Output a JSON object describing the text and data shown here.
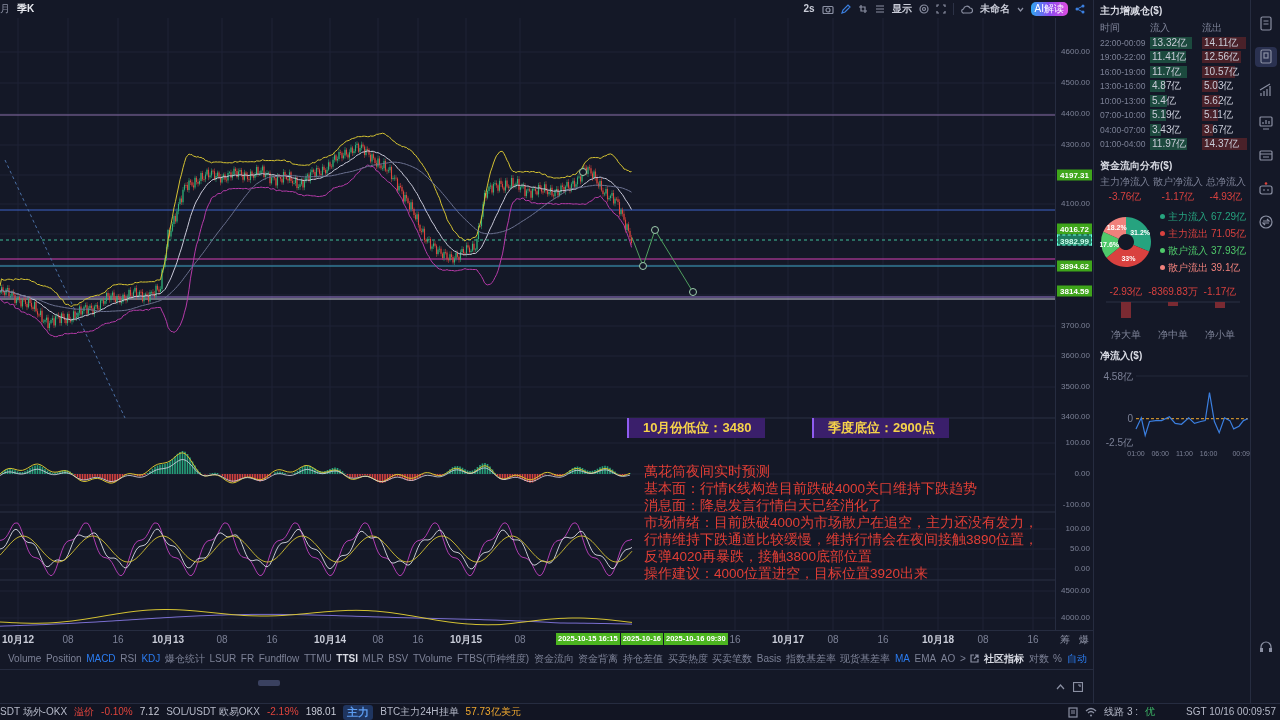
{
  "top_bar": {
    "periods": [
      {
        "label": "月",
        "selected": false
      },
      {
        "label": "季K",
        "selected": true
      }
    ],
    "interval": "2s",
    "display_label": "显示",
    "layout_name": "未命名",
    "ai_button": "AI解读"
  },
  "price_axis": {
    "labels": [
      "4600.00",
      "4500.00",
      "4400.00",
      "4300.00",
      "4100.00",
      "3700.00",
      "3600.00",
      "3500.00",
      "3400.00"
    ],
    "markers": [
      {
        "label": "4197.31",
        "kind": "price"
      },
      {
        "label": "4016.72",
        "kind": "price"
      },
      {
        "label": "3982.99",
        "kind": "current"
      },
      {
        "label": "3894.62",
        "kind": "price"
      },
      {
        "label": "3814.59",
        "kind": "price"
      }
    ]
  },
  "indicator_axes": [
    {
      "labels": [
        "100.00",
        "0.00",
        "-100.00"
      ]
    },
    {
      "labels": [
        "100.00",
        "50.00",
        "0.00"
      ]
    },
    {
      "labels": [
        "4500.00",
        "4000.00"
      ]
    }
  ],
  "chart_annotations": {
    "boxes": [
      "10月份低位：3480",
      "季度底位：2900点"
    ],
    "note_lines": [
      "萬花筒夜间实时预测",
      "基本面：行情K线构造目前跌破4000关口维持下跌趋势",
      "消息面：降息发言行情白天已经消化了",
      "市场情绪：目前跌破4000为市场散户在追空，主力还没有发力，",
      "行情维持下跌通道比较缓慢，维持行情会在夜间接触3890位置，",
      "反弹4020再暴跌，接触3800底部位置",
      "操作建议：4000位置进空，目标位置3920出来"
    ]
  },
  "time_axis": [
    {
      "label": "10月12",
      "kind": "day"
    },
    {
      "label": "08",
      "kind": "hour"
    },
    {
      "label": "16",
      "kind": "hour"
    },
    {
      "label": "10月13",
      "kind": "day"
    },
    {
      "label": "08",
      "kind": "hour"
    },
    {
      "label": "16",
      "kind": "hour"
    },
    {
      "label": "10月14",
      "kind": "day"
    },
    {
      "label": "08",
      "kind": "hour"
    },
    {
      "label": "16",
      "kind": "hour"
    },
    {
      "label": "10月15",
      "kind": "day"
    },
    {
      "label": "08",
      "kind": "hour"
    },
    {
      "label": "2025-10-15 16:15",
      "kind": "cursor"
    },
    {
      "label": "2025-10-16",
      "kind": "cursor"
    },
    {
      "label": "2025-10-16 09:30",
      "kind": "cursor"
    },
    {
      "label": "16",
      "kind": "hour"
    },
    {
      "label": "10月17",
      "kind": "day"
    },
    {
      "label": "08",
      "kind": "hour"
    },
    {
      "label": "16",
      "kind": "hour"
    },
    {
      "label": "10月18",
      "kind": "day"
    },
    {
      "label": "08",
      "kind": "hour"
    },
    {
      "label": "16",
      "kind": "hour"
    }
  ],
  "axis_corner": [
    "筹",
    "爆"
  ],
  "indicator_tabs": [
    {
      "label": "Volume",
      "selected": false,
      "emphasized": false
    },
    {
      "label": "Position",
      "selected": false,
      "emphasized": false
    },
    {
      "label": "MACD",
      "selected": true,
      "emphasized": false
    },
    {
      "label": "RSI",
      "selected": false,
      "emphasized": false
    },
    {
      "label": "KDJ",
      "selected": true,
      "emphasized": false
    },
    {
      "label": "爆仓统计",
      "selected": false,
      "emphasized": false
    },
    {
      "label": "LSUR",
      "selected": false,
      "emphasized": false
    },
    {
      "label": "FR",
      "selected": false,
      "emphasized": false
    },
    {
      "label": "Fundflow",
      "selected": false,
      "emphasized": false
    },
    {
      "label": "TTMU",
      "selected": false,
      "emphasized": false
    },
    {
      "label": "TTSI",
      "selected": false,
      "emphasized": true
    },
    {
      "label": "MLR",
      "selected": false,
      "emphasized": false
    },
    {
      "label": "BSV",
      "selected": false,
      "emphasized": false
    },
    {
      "label": "TVolume",
      "selected": false,
      "emphasized": false
    },
    {
      "label": "FTBS(币种维度)",
      "selected": false,
      "emphasized": false
    },
    {
      "label": "资金流向",
      "selected": false,
      "emphasized": false
    },
    {
      "label": "资金背离",
      "selected": false,
      "emphasized": false
    },
    {
      "label": "持仓差值",
      "selected": false,
      "emphasized": false
    },
    {
      "label": "买卖热度",
      "selected": false,
      "emphasized": false
    },
    {
      "label": "买卖笔数",
      "selected": false,
      "emphasized": false
    },
    {
      "label": "Basis",
      "selected": false,
      "emphasized": false
    },
    {
      "label": "指数基差率",
      "selected": false,
      "emphasized": false
    },
    {
      "label": "现货基差率",
      "selected": false,
      "emphasized": false
    },
    {
      "label": "MA",
      "selected": true,
      "emphasized": false
    },
    {
      "label": "EMA",
      "selected": false,
      "emphasized": false
    },
    {
      "label": "AO",
      "selected": false,
      "emphasized": false
    },
    {
      "label": ">",
      "selected": false,
      "emphasized": false
    },
    {
      "label": "社区指标",
      "selected": false,
      "emphasized": true
    },
    {
      "label": "对数",
      "selected": false,
      "emphasized": false
    },
    {
      "label": "%",
      "selected": false,
      "emphasized": false
    },
    {
      "label": "自动",
      "selected": true,
      "emphasized": false
    }
  ],
  "status_bar": {
    "ticker": [
      {
        "text": "SDT 场外-OKX",
        "kind": "name"
      },
      {
        "text": "溢价",
        "kind": "down"
      },
      {
        "text": "-0.10%",
        "kind": "down"
      },
      {
        "text": "7.12",
        "kind": "value"
      },
      {
        "text": "SOL/USDT 欧易OKX",
        "kind": "name"
      },
      {
        "text": "-2.19%",
        "kind": "down"
      },
      {
        "text": "198.01",
        "kind": "value"
      },
      {
        "text": "主力",
        "kind": "badge"
      },
      {
        "text": "BTC主力24H挂单",
        "kind": "name"
      },
      {
        "text": "57.73亿美元",
        "kind": "highlight"
      }
    ],
    "line_label": "线路 3 :",
    "line_quality": "优",
    "clock": "SGT 10/16 00:09:57"
  },
  "fund_panel": {
    "inflow_table": {
      "title": "主力增减仓($)",
      "columns": [
        "时间",
        "流入",
        "流出"
      ],
      "rows": [
        {
          "time": "22:00-00:09",
          "inflow": "13.32亿",
          "outflow": "14.11亿"
        },
        {
          "time": "19:00-22:00",
          "inflow": "11.41亿",
          "outflow": "12.56亿"
        },
        {
          "time": "16:00-19:00",
          "inflow": "11.7亿",
          "outflow": "10.57亿"
        },
        {
          "time": "13:00-16:00",
          "inflow": "4.87亿",
          "outflow": "5.03亿"
        },
        {
          "time": "10:00-13:00",
          "inflow": "5.4亿",
          "outflow": "5.62亿"
        },
        {
          "time": "07:00-10:00",
          "inflow": "5.19亿",
          "outflow": "5.11亿"
        },
        {
          "time": "04:00-07:00",
          "inflow": "3.43亿",
          "outflow": "3.67亿"
        },
        {
          "time": "01:00-04:00",
          "inflow": "11.97亿",
          "outflow": "14.37亿"
        }
      ]
    },
    "distribution": {
      "title": "资金流向分布($)",
      "stats": [
        {
          "label": "主力净流入",
          "value": "-3.76亿"
        },
        {
          "label": "散户净流入",
          "value": "-1.17亿"
        },
        {
          "label": "总净流入",
          "value": "-4.93亿"
        }
      ],
      "donut": {
        "chart_data": {
          "type": "donut",
          "categories": [
            "主力流入",
            "主力流出",
            "散户流入",
            "散户流出"
          ],
          "values": [
            31.2,
            33,
            17.6,
            18.2
          ],
          "value_labels": [
            "31.2%",
            "33%",
            "17.6%",
            "18.2%"
          ]
        }
      },
      "legend": [
        {
          "amount": "67.29亿",
          "color": "#26a37f"
        },
        {
          "amount": "71.05亿",
          "color": "#d9413f"
        },
        {
          "amount": "37.93亿",
          "color": "#4fc86a"
        },
        {
          "amount": "39.1亿",
          "color": "#f0817c"
        }
      ],
      "net_orders": [
        {
          "category": "净大单",
          "value": "-2.93亿"
        },
        {
          "category": "净中单",
          "value": "-8369.83万"
        },
        {
          "category": "净小单",
          "value": "-1.17亿"
        }
      ]
    },
    "net_inflow": {
      "title": "净流入($)",
      "chart_data": {
        "type": "line",
        "x": [
          1,
          2.1,
          2.9,
          3.8,
          5.1,
          6.3,
          7.9,
          9.1,
          10.4,
          11.9,
          13.1,
          14.4,
          15.3,
          16.2,
          17.2,
          18.2,
          19.3,
          20.4,
          21.2,
          22.3,
          23.2,
          24.1
        ],
        "series": [
          {
            "color": "#3b7fe0",
            "values": [
              -1.1,
              0.1,
              -1.8,
              -0.3,
              -0.2,
              -0.2,
              0.2,
              -0.5,
              -0.6,
              0.1,
              -0.5,
              -0.3,
              -0.2,
              2.8,
              -0.3,
              -1.5,
              0.1,
              -0.2,
              -1.1,
              -0.8,
              -0.2,
              0
            ]
          },
          {
            "color": "#f0a930",
            "line_style": "dashed",
            "values": [
              0,
              0,
              0,
              0,
              0,
              0,
              0,
              0,
              0,
              0,
              0,
              0,
              0,
              0,
              0,
              0,
              0,
              0,
              0,
              0,
              0,
              0
            ]
          }
        ],
        "xlim": [
          1,
          24.15
        ],
        "ylim": [
          -2.5,
          4.58
        ],
        "yticks": [
          {
            "value": 4.58,
            "label": "4.58亿"
          },
          {
            "value": 0,
            "label": "0"
          },
          {
            "value": -2.5,
            "label": "-2.5亿"
          }
        ],
        "xticks": [
          {
            "value": 1,
            "label": "01:00"
          },
          {
            "value": 6,
            "label": "06:00"
          },
          {
            "value": 11,
            "label": "11:00"
          },
          {
            "value": 16,
            "label": "16:00"
          }
        ]
      },
      "x_end_label": "00:09"
    }
  },
  "side_rail": [
    {
      "selected": false
    },
    {
      "selected": true
    },
    {
      "selected": false
    },
    {
      "selected": false
    },
    {
      "selected": false
    },
    {
      "selected": false
    },
    {
      "selected": false
    }
  ]
}
